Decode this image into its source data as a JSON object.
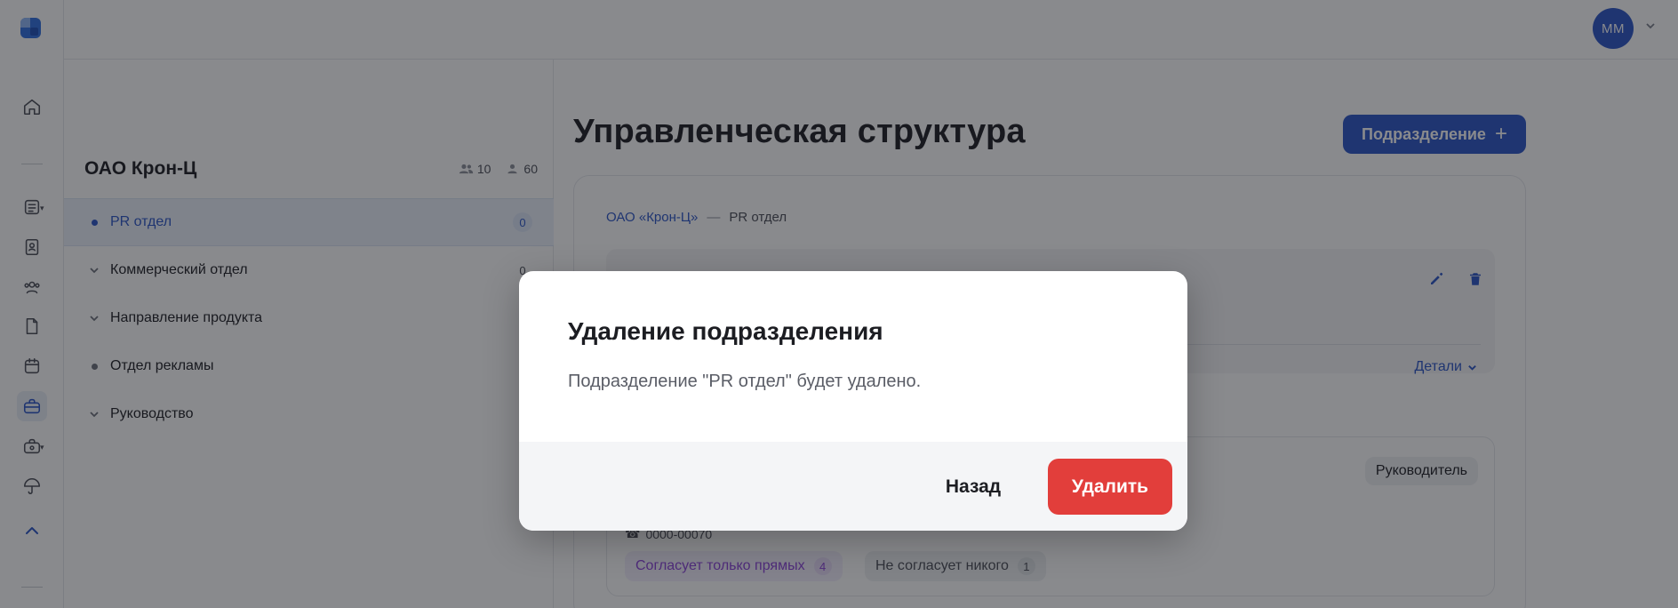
{
  "user": {
    "initials": "MM"
  },
  "org": {
    "title": "ОАО Крон-Ц",
    "departments_count": "10",
    "employees_count": "60"
  },
  "tree": {
    "items": [
      {
        "label": "PR отдел",
        "count": "0",
        "marker": "dot",
        "selected": true
      },
      {
        "label": "Коммерческий отдел",
        "count": "0",
        "marker": "chevron",
        "selected": false
      },
      {
        "label": "Направление продукта",
        "count": "",
        "marker": "chevron",
        "selected": false
      },
      {
        "label": "Отдел рекламы",
        "count": "",
        "marker": "dot",
        "selected": false
      },
      {
        "label": "Руководство",
        "count": "",
        "marker": "chevron",
        "selected": false
      }
    ]
  },
  "main": {
    "title": "Управленческая структура",
    "add_button": "Подразделение",
    "breadcrumb": {
      "root": "ОАО «Крон-Ц»",
      "separator": "—",
      "current": "PR отдел"
    },
    "details_link": "Детали",
    "employee": {
      "role": "Руководитель",
      "phone": "0000-00070",
      "tags": [
        {
          "label": "Согласует только прямых",
          "count": "4"
        },
        {
          "label": "Не согласует никого",
          "count": "1"
        }
      ]
    }
  },
  "modal": {
    "title": "Удаление подразделения",
    "message": "Подразделение \"PR отдел\" будет удалено.",
    "back_label": "Назад",
    "delete_label": "Удалить"
  },
  "colors": {
    "accent": "#2b55c7",
    "danger": "#e23e3b",
    "selected_bg": "#eaf0fb"
  }
}
